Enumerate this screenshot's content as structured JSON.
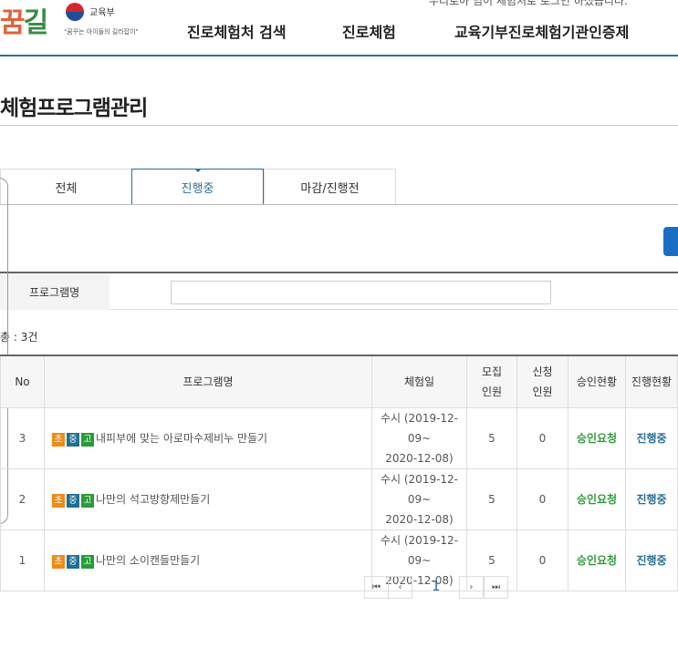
{
  "header": {
    "logo": "꿈길",
    "ministry": "교육부",
    "slogan": "\"꿈꾸는 아이들의 길라잡이\"",
    "login_text": "우리로아 님이 체험처로 로그인 하셨습니다.",
    "nav": [
      "진로체험처 검색",
      "진로체험",
      "교육기부진로체험기관인증제"
    ]
  },
  "page_title": "체험프로그램관리",
  "tabs": [
    "전체",
    "진행중",
    "마감/진행전"
  ],
  "active_tab": "진행중",
  "search": {
    "label": "프로그램명",
    "value": ""
  },
  "count": "총 : 3건",
  "table": {
    "headers": [
      "No",
      "프로그램명",
      "체험일",
      "모집\n인원",
      "신청\n인원",
      "승인현황",
      "진행현황"
    ],
    "rows": [
      {
        "no": "3",
        "badges": [
          "초",
          "중",
          "고"
        ],
        "name": "내피부에 맞는 아로마수제비누 만들기",
        "date1": "수시 (2019-12-09~",
        "date2": "2020-12-08)",
        "recruit": "5",
        "applied": "0",
        "approval": "승인요청",
        "progress": "진행중"
      },
      {
        "no": "2",
        "badges": [
          "초",
          "중",
          "고"
        ],
        "name": "나만의 석고방향제만들기",
        "date1": "수시 (2019-12-09~",
        "date2": "2020-12-08)",
        "recruit": "5",
        "applied": "0",
        "approval": "승인요청",
        "progress": "진행중"
      },
      {
        "no": "1",
        "badges": [
          "초",
          "중",
          "고"
        ],
        "name": "나만의 소이캔들만들기",
        "date1": "수시 (2019-12-09~",
        "date2": "2020-12-08)",
        "recruit": "5",
        "applied": "0",
        "approval": "승인요청",
        "progress": "진행중"
      }
    ]
  },
  "badge_colors": [
    "#ef8a17",
    "#1f6e96",
    "#2a9a3a"
  ],
  "pagination": {
    "first": "⏮",
    "prev": "‹",
    "current": "1",
    "next": "›",
    "last": "⏭"
  }
}
